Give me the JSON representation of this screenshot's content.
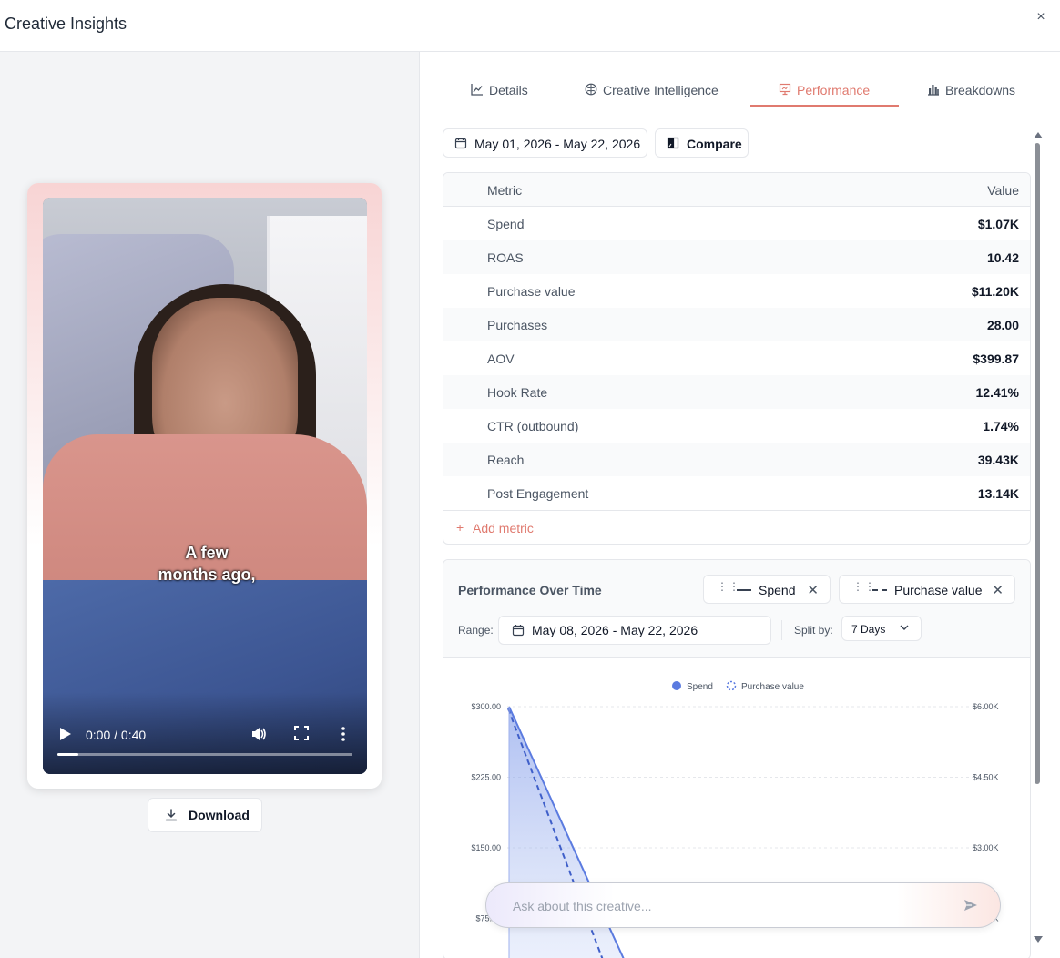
{
  "window": {
    "title": "Creative Insights",
    "close_icon": "×"
  },
  "video": {
    "caption_line1": "A few",
    "caption_line2": "months ago,",
    "time": "0:00 / 0:40",
    "progress": 0.07
  },
  "download": {
    "label": "Download"
  },
  "tabs": [
    {
      "label": "Details",
      "icon": "line-chart-icon"
    },
    {
      "label": "Creative Intelligence",
      "icon": "brain-icon"
    },
    {
      "label": "Performance",
      "icon": "presentation-icon",
      "active": true
    },
    {
      "label": "Breakdowns",
      "icon": "bar-chart-icon"
    }
  ],
  "toolbar": {
    "date_range": "May 01, 2026 - May 22, 2026",
    "compare_label": "Compare"
  },
  "metrics": {
    "header_metric": "Metric",
    "header_value": "Value",
    "rows": [
      {
        "name": "Spend",
        "value": "$1.07K"
      },
      {
        "name": "ROAS",
        "value": "10.42"
      },
      {
        "name": "Purchase value",
        "value": "$11.20K"
      },
      {
        "name": "Purchases",
        "value": "28.00"
      },
      {
        "name": "AOV",
        "value": "$399.87"
      },
      {
        "name": "Hook Rate",
        "value": "12.41%"
      },
      {
        "name": "CTR (outbound)",
        "value": "1.74%"
      },
      {
        "name": "Reach",
        "value": "39.43K"
      },
      {
        "name": "Post Engagement",
        "value": "13.14K"
      }
    ],
    "add_metric": "Add metric"
  },
  "performance": {
    "title": "Performance Over Time",
    "chips": [
      {
        "label": "Spend"
      },
      {
        "label": "Purchase value"
      }
    ],
    "range_label": "Range:",
    "range_value": "May 08, 2026 - May 22, 2026",
    "split_label": "Split by:",
    "split_value": "7 Days"
  },
  "chart_data": {
    "type": "line",
    "legend_position": "top-center",
    "series": [
      {
        "name": "Spend",
        "axis": "left",
        "style": "solid",
        "fill": true,
        "color": "#5b7be0"
      },
      {
        "name": "Purchase value",
        "axis": "right",
        "style": "dashed",
        "color": "#3f5fc9"
      }
    ],
    "y_left": {
      "ticks": [
        "$300.00",
        "$225.00",
        "$150.00",
        "$75.00"
      ],
      "ylim": [
        75,
        300
      ]
    },
    "y_right": {
      "ticks": [
        "$6.00K",
        "$4.50K",
        "$3.00K",
        "$1.50K"
      ],
      "ylim": [
        1500,
        6000
      ]
    },
    "visible_segment": {
      "spend_start": 300,
      "purchase_value_start": 6000
    },
    "grid": true
  },
  "ask": {
    "placeholder": "Ask about this creative..."
  },
  "colors": {
    "accent": "#e07a6f",
    "series": "#5b7be0"
  }
}
